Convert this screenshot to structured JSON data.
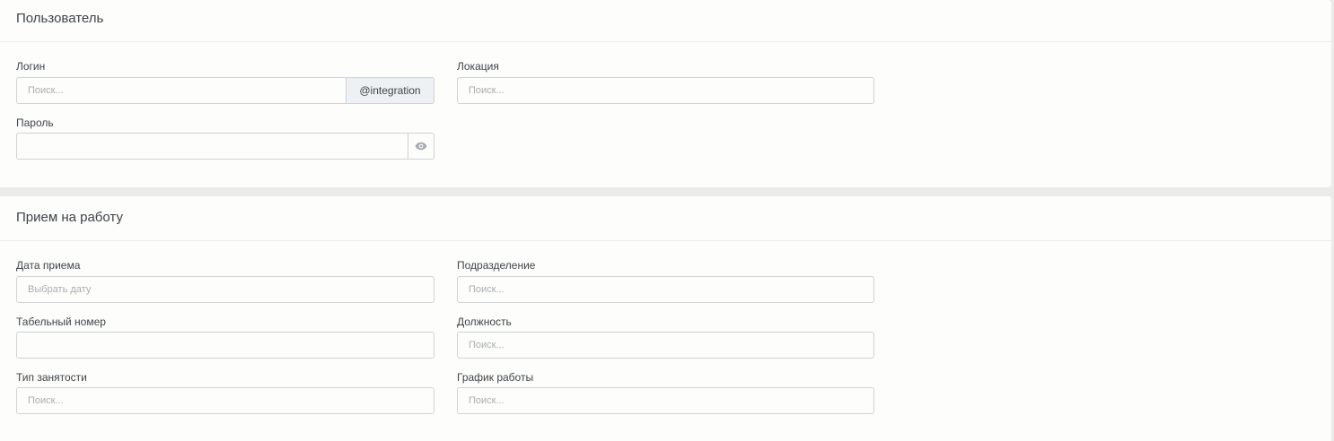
{
  "user_section": {
    "title": "Пользователь",
    "login": {
      "label": "Логин",
      "placeholder": "Поиск...",
      "value": "",
      "suffix": "@integration"
    },
    "location": {
      "label": "Локация",
      "placeholder": "Поиск...",
      "value": ""
    },
    "password": {
      "label": "Пароль",
      "value": "",
      "toggle_icon": "eye-icon"
    }
  },
  "hire_section": {
    "title": "Прием на работу",
    "hire_date": {
      "label": "Дата приема",
      "placeholder": "Выбрать дату",
      "value": ""
    },
    "department": {
      "label": "Подразделение",
      "placeholder": "Поиск...",
      "value": ""
    },
    "employee_number": {
      "label": "Табельный номер",
      "value": ""
    },
    "position": {
      "label": "Должность",
      "placeholder": "Поиск...",
      "value": ""
    },
    "employment_type": {
      "label": "Тип занятости",
      "placeholder": "Поиск...",
      "value": ""
    },
    "work_schedule": {
      "label": "График работы",
      "placeholder": "Поиск...",
      "value": ""
    }
  },
  "colors": {
    "page_background": "#ebebea",
    "card_background": "#fdfdfb",
    "input_border": "#cfd2d6",
    "addon_background": "#eef1f4",
    "placeholder_text": "#a9adb2",
    "icon": "#a7abb0"
  }
}
